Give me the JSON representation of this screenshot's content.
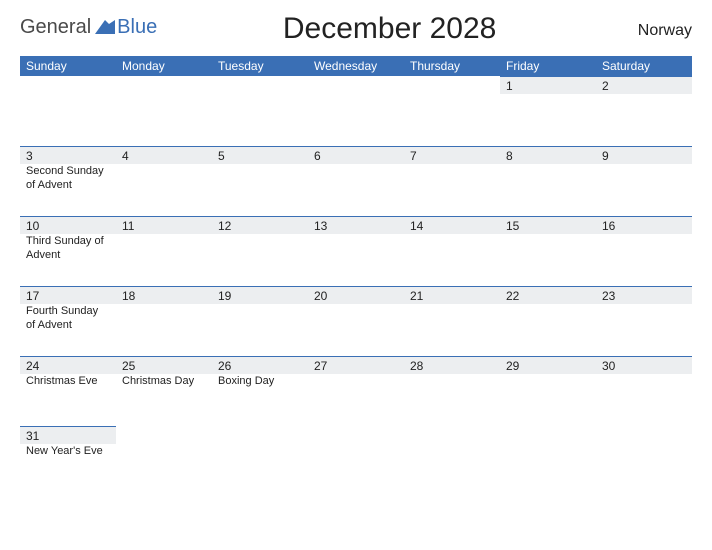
{
  "brand": {
    "general": "General",
    "blue": "Blue"
  },
  "title": "December 2028",
  "country": "Norway",
  "day_headers": [
    "Sunday",
    "Monday",
    "Tuesday",
    "Wednesday",
    "Thursday",
    "Friday",
    "Saturday"
  ],
  "weeks": [
    [
      {
        "date": "",
        "event": ""
      },
      {
        "date": "",
        "event": ""
      },
      {
        "date": "",
        "event": ""
      },
      {
        "date": "",
        "event": ""
      },
      {
        "date": "",
        "event": ""
      },
      {
        "date": "1",
        "event": ""
      },
      {
        "date": "2",
        "event": ""
      }
    ],
    [
      {
        "date": "3",
        "event": "Second Sunday of Advent"
      },
      {
        "date": "4",
        "event": ""
      },
      {
        "date": "5",
        "event": ""
      },
      {
        "date": "6",
        "event": ""
      },
      {
        "date": "7",
        "event": ""
      },
      {
        "date": "8",
        "event": ""
      },
      {
        "date": "9",
        "event": ""
      }
    ],
    [
      {
        "date": "10",
        "event": "Third Sunday of Advent"
      },
      {
        "date": "11",
        "event": ""
      },
      {
        "date": "12",
        "event": ""
      },
      {
        "date": "13",
        "event": ""
      },
      {
        "date": "14",
        "event": ""
      },
      {
        "date": "15",
        "event": ""
      },
      {
        "date": "16",
        "event": ""
      }
    ],
    [
      {
        "date": "17",
        "event": "Fourth Sunday of Advent"
      },
      {
        "date": "18",
        "event": ""
      },
      {
        "date": "19",
        "event": ""
      },
      {
        "date": "20",
        "event": ""
      },
      {
        "date": "21",
        "event": ""
      },
      {
        "date": "22",
        "event": ""
      },
      {
        "date": "23",
        "event": ""
      }
    ],
    [
      {
        "date": "24",
        "event": "Christmas Eve"
      },
      {
        "date": "25",
        "event": "Christmas Day"
      },
      {
        "date": "26",
        "event": "Boxing Day"
      },
      {
        "date": "27",
        "event": ""
      },
      {
        "date": "28",
        "event": ""
      },
      {
        "date": "29",
        "event": ""
      },
      {
        "date": "30",
        "event": ""
      }
    ],
    [
      {
        "date": "31",
        "event": "New Year's Eve"
      },
      {
        "date": "",
        "event": ""
      },
      {
        "date": "",
        "event": ""
      },
      {
        "date": "",
        "event": ""
      },
      {
        "date": "",
        "event": ""
      },
      {
        "date": "",
        "event": ""
      },
      {
        "date": "",
        "event": ""
      }
    ]
  ]
}
